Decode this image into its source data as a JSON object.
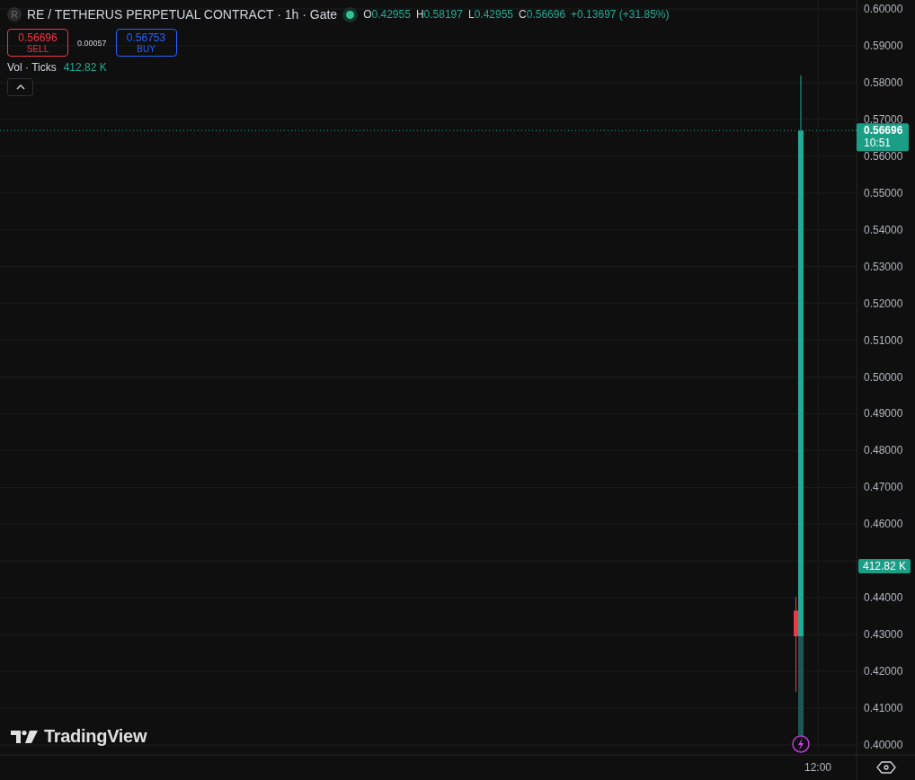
{
  "legend": {
    "symbol_logo": "R",
    "title": "RE / TETHERUS PERPETUAL CONTRACT · 1h · Gate",
    "market_open": true,
    "ohlc": [
      {
        "key": "O",
        "value": "0.42955"
      },
      {
        "key": "H",
        "value": "0.58197"
      },
      {
        "key": "L",
        "value": "0.42955"
      },
      {
        "key": "C",
        "value": "0.56696"
      }
    ],
    "change": "+0.13697 (+31.85%)"
  },
  "trade": {
    "sell": {
      "price": "0.56696",
      "label": "SELL"
    },
    "spread": "0.00057",
    "buy": {
      "price": "0.56753",
      "label": "BUY"
    }
  },
  "volume_legend": {
    "name": "Vol · Ticks",
    "value": "412.82 K"
  },
  "chart": {
    "price_axis_upper": [
      "0.60000",
      "0.59000",
      "0.58000",
      "0.57000",
      "0.56000",
      "0.55000",
      "0.54000",
      "0.53000",
      "0.52000",
      "0.51000",
      "0.50000",
      "0.49000",
      "0.48000",
      "0.47000",
      "0.46000"
    ],
    "price_axis_lower": [
      "0.44000",
      "0.43000",
      "0.42000",
      "0.41000",
      "0.40000"
    ],
    "time_axis": [
      "12:00"
    ],
    "last_price": {
      "price": "0.56696",
      "countdown": "10:51"
    },
    "volume_label": "412.82 K"
  },
  "branding": {
    "text": "TradingView"
  }
}
